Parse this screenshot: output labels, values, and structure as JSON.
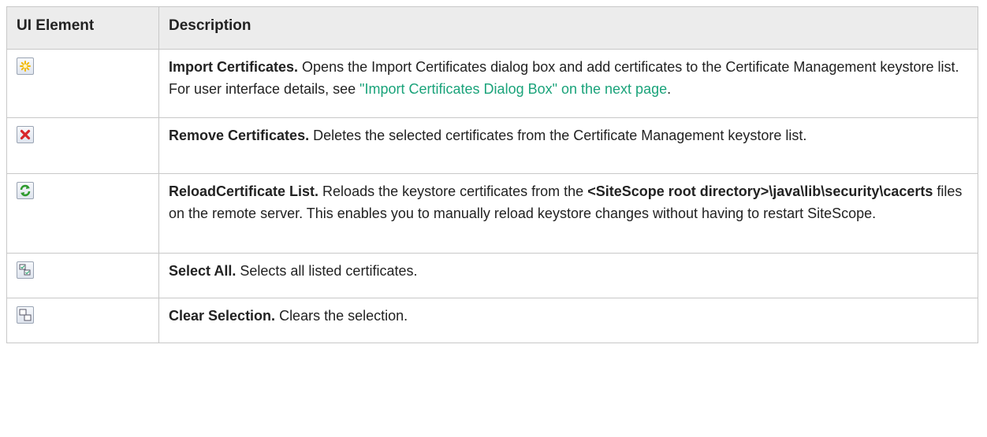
{
  "headers": {
    "element": "UI Element",
    "description": "Description"
  },
  "rows": [
    {
      "icon": "import-certificates-icon",
      "title": "Import Certificates.",
      "text1": " Opens the Import Certificates dialog box and add certificates to the Certificate Management keystore list. For user interface details, see ",
      "link": "\"Import Certificates Dialog Box\" on the next page",
      "text2": "."
    },
    {
      "icon": "remove-certificates-icon",
      "title": "Remove Certificates.",
      "text1": " Deletes the selected certificates from the Certificate Management keystore list."
    },
    {
      "icon": "reload-certificate-list-icon",
      "title": "ReloadCertificate List.",
      "text1": " Reloads the keystore certificates from the ",
      "bold_path": "<SiteScope root directory>\\java\\lib\\security\\cacerts",
      "text2": " files on the remote server. This enables you to manually reload keystore changes without having to restart SiteScope."
    },
    {
      "icon": "select-all-icon",
      "title": "Select All.",
      "text1": " Selects all listed certificates."
    },
    {
      "icon": "clear-selection-icon",
      "title": "Clear Selection.",
      "text1": " Clears the selection."
    }
  ],
  "colors": {
    "link": "#1aa37a",
    "header_bg": "#ececec",
    "border": "#c8c8c8"
  }
}
